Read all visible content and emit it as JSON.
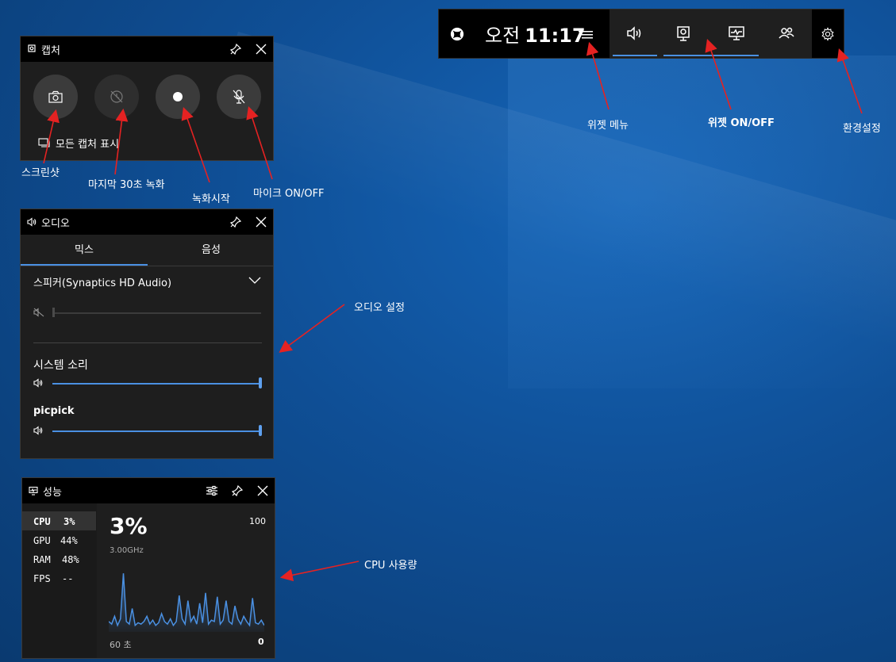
{
  "colors": {
    "accent": "#4a90e2",
    "arrow": "#e52222",
    "panel": "#1e1e1e",
    "titlebar": "#000000"
  },
  "gamebar": {
    "ampm": "오전",
    "time": "11:17",
    "icons": [
      "xbox-icon",
      "widget-menu-icon",
      "audio-icon",
      "capture-icon",
      "performance-icon",
      "social-icon",
      "settings-icon"
    ]
  },
  "capture": {
    "title": "캡처",
    "show_all": "모든 캡처 표시",
    "buttons": [
      "screenshot",
      "record-last-30s",
      "start-recording",
      "mic-toggle"
    ]
  },
  "audio": {
    "title": "오디오",
    "tabs": [
      "믹스",
      "음성"
    ],
    "device": "스피커(Synaptics HD Audio)",
    "apps": [
      {
        "name": "시스템 소리",
        "level": 1.0
      },
      {
        "name": "picpick",
        "level": 1.0
      }
    ],
    "master_level": 0.0
  },
  "performance": {
    "title": "성능",
    "stats": [
      {
        "label": "CPU",
        "value": "3%"
      },
      {
        "label": "GPU",
        "value": "44%"
      },
      {
        "label": "RAM",
        "value": "48%"
      },
      {
        "label": "FPS",
        "value": "--"
      }
    ],
    "big_value": "3%",
    "freq": "3.00GHz",
    "max": "100",
    "min": "0",
    "window": "60 초"
  },
  "annotations": {
    "widget_menu": "위젯 메뉴",
    "widget_onoff": "위젯 ON/OFF",
    "settings": "환경설정",
    "screenshot": "스크린샷",
    "last30": "마지막 30초 녹화",
    "record": "녹화시작",
    "mic": "마이크 ON/OFF",
    "audio_settings": "오디오 설정",
    "cpu_usage": "CPU 사용량"
  },
  "chart_data": {
    "type": "area",
    "title": "",
    "series": [
      {
        "values": [
          8,
          6,
          12,
          5,
          10,
          45,
          8,
          6,
          18,
          5,
          7,
          6,
          8,
          12,
          6,
          9,
          5,
          7,
          14,
          8,
          6,
          10,
          5,
          8,
          28,
          10,
          6,
          24,
          8,
          12,
          6,
          22,
          7,
          30,
          6,
          9,
          8,
          27,
          6,
          9,
          24,
          8,
          6,
          20,
          10,
          6,
          12,
          8,
          5,
          26,
          7,
          6,
          9,
          5
        ]
      }
    ],
    "ylim": [
      0,
      100
    ]
  }
}
